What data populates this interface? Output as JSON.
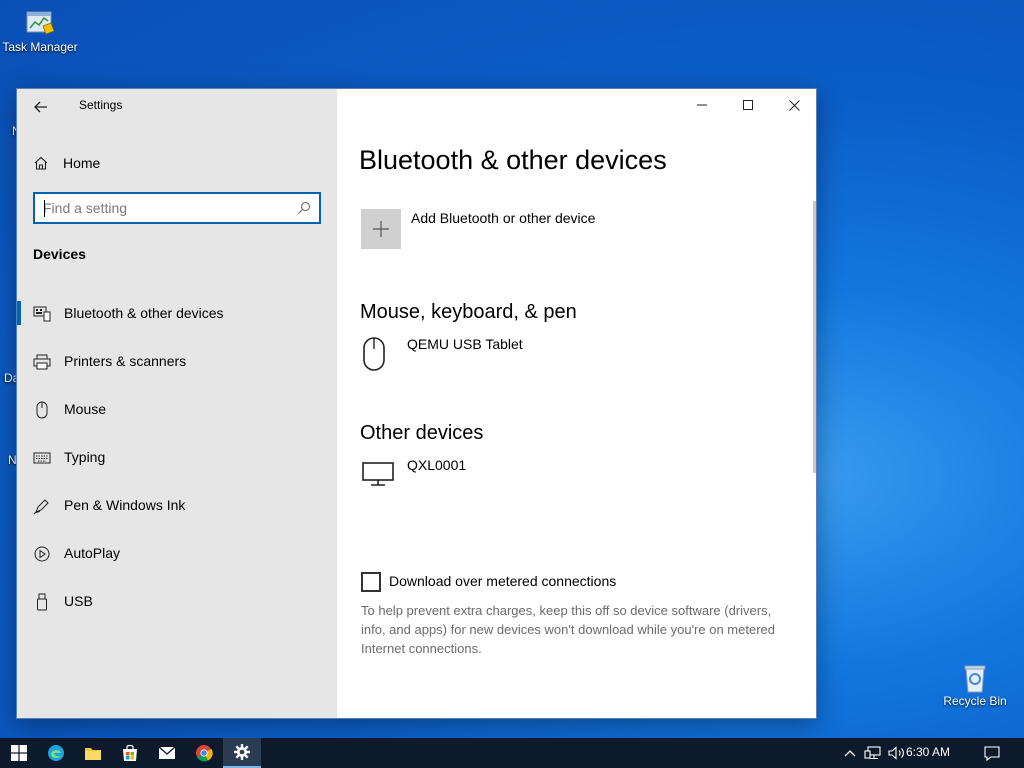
{
  "desktop": {
    "icons": [
      {
        "label": "Task Manager"
      },
      {
        "label": "Recycle Bin"
      }
    ],
    "fragments": [
      "N",
      "Da",
      "N"
    ]
  },
  "window": {
    "title": "Settings",
    "back_icon": "arrow-left-icon",
    "controls": [
      "minimize-icon",
      "maximize-icon",
      "close-icon"
    ]
  },
  "sidebar": {
    "home_label": "Home",
    "search": {
      "placeholder": "Find a setting",
      "value": ""
    },
    "section": "Devices",
    "items": [
      {
        "label": "Bluetooth & other devices",
        "icon": "bluetooth-devices-icon",
        "active": true
      },
      {
        "label": "Printers & scanners",
        "icon": "printer-icon"
      },
      {
        "label": "Mouse",
        "icon": "mouse-icon"
      },
      {
        "label": "Typing",
        "icon": "keyboard-icon"
      },
      {
        "label": "Pen & Windows Ink",
        "icon": "pen-icon"
      },
      {
        "label": "AutoPlay",
        "icon": "autoplay-icon"
      },
      {
        "label": "USB",
        "icon": "usb-icon"
      }
    ]
  },
  "main": {
    "title": "Bluetooth & other devices",
    "add_device_label": "Add Bluetooth or other device",
    "groups": [
      {
        "heading": "Mouse, keyboard, & pen",
        "devices": [
          {
            "name": "QEMU USB Tablet",
            "icon": "mouse-icon"
          }
        ]
      },
      {
        "heading": "Other devices",
        "devices": [
          {
            "name": "QXL0001",
            "icon": "monitor-icon"
          }
        ]
      }
    ],
    "metered": {
      "label": "Download over metered connections",
      "checked": false,
      "description": "To help prevent extra charges, keep this off so device software (drivers, info, and apps) for new devices won't download while you're on metered Internet connections."
    }
  },
  "taskbar": {
    "apps": [
      "windows-start-icon",
      "edge-icon",
      "file-explorer-icon",
      "store-icon",
      "mail-icon",
      "chrome-icon",
      "settings-icon"
    ],
    "clock": "6:30 AM",
    "accent": "#0063b1"
  }
}
